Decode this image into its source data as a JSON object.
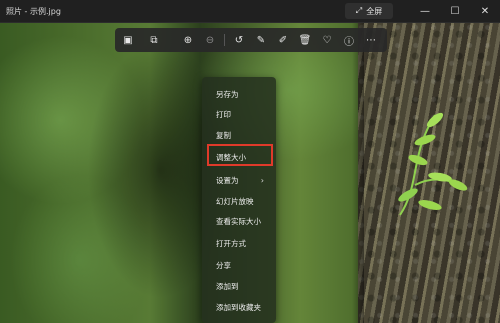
{
  "window": {
    "title": "照片 - 示例.jpg",
    "fullscreen_label": "全屏"
  },
  "toolbar": {
    "icons": [
      "image-icon",
      "crop-icon",
      "zoom-in-icon",
      "zoom-out-icon",
      "rotate-icon",
      "edit-icon",
      "draw-icon",
      "delete-icon",
      "favorite-icon",
      "info-icon",
      "more-icon"
    ]
  },
  "menu": {
    "items": [
      {
        "label": "另存为"
      },
      {
        "label": "打印"
      },
      {
        "label": "复制"
      },
      {
        "label": "调整大小"
      },
      {
        "label": "设置为",
        "submenu": true
      },
      {
        "label": "幻灯片放映"
      },
      {
        "label": "查看实际大小"
      },
      {
        "label": "打开方式"
      },
      {
        "label": "分享"
      },
      {
        "label": "添加到"
      },
      {
        "label": "添加到收藏夹"
      }
    ],
    "highlighted_item": "调整大小"
  },
  "colors": {
    "highlight_border": "#e03a2a",
    "titlebar": "#202020"
  }
}
